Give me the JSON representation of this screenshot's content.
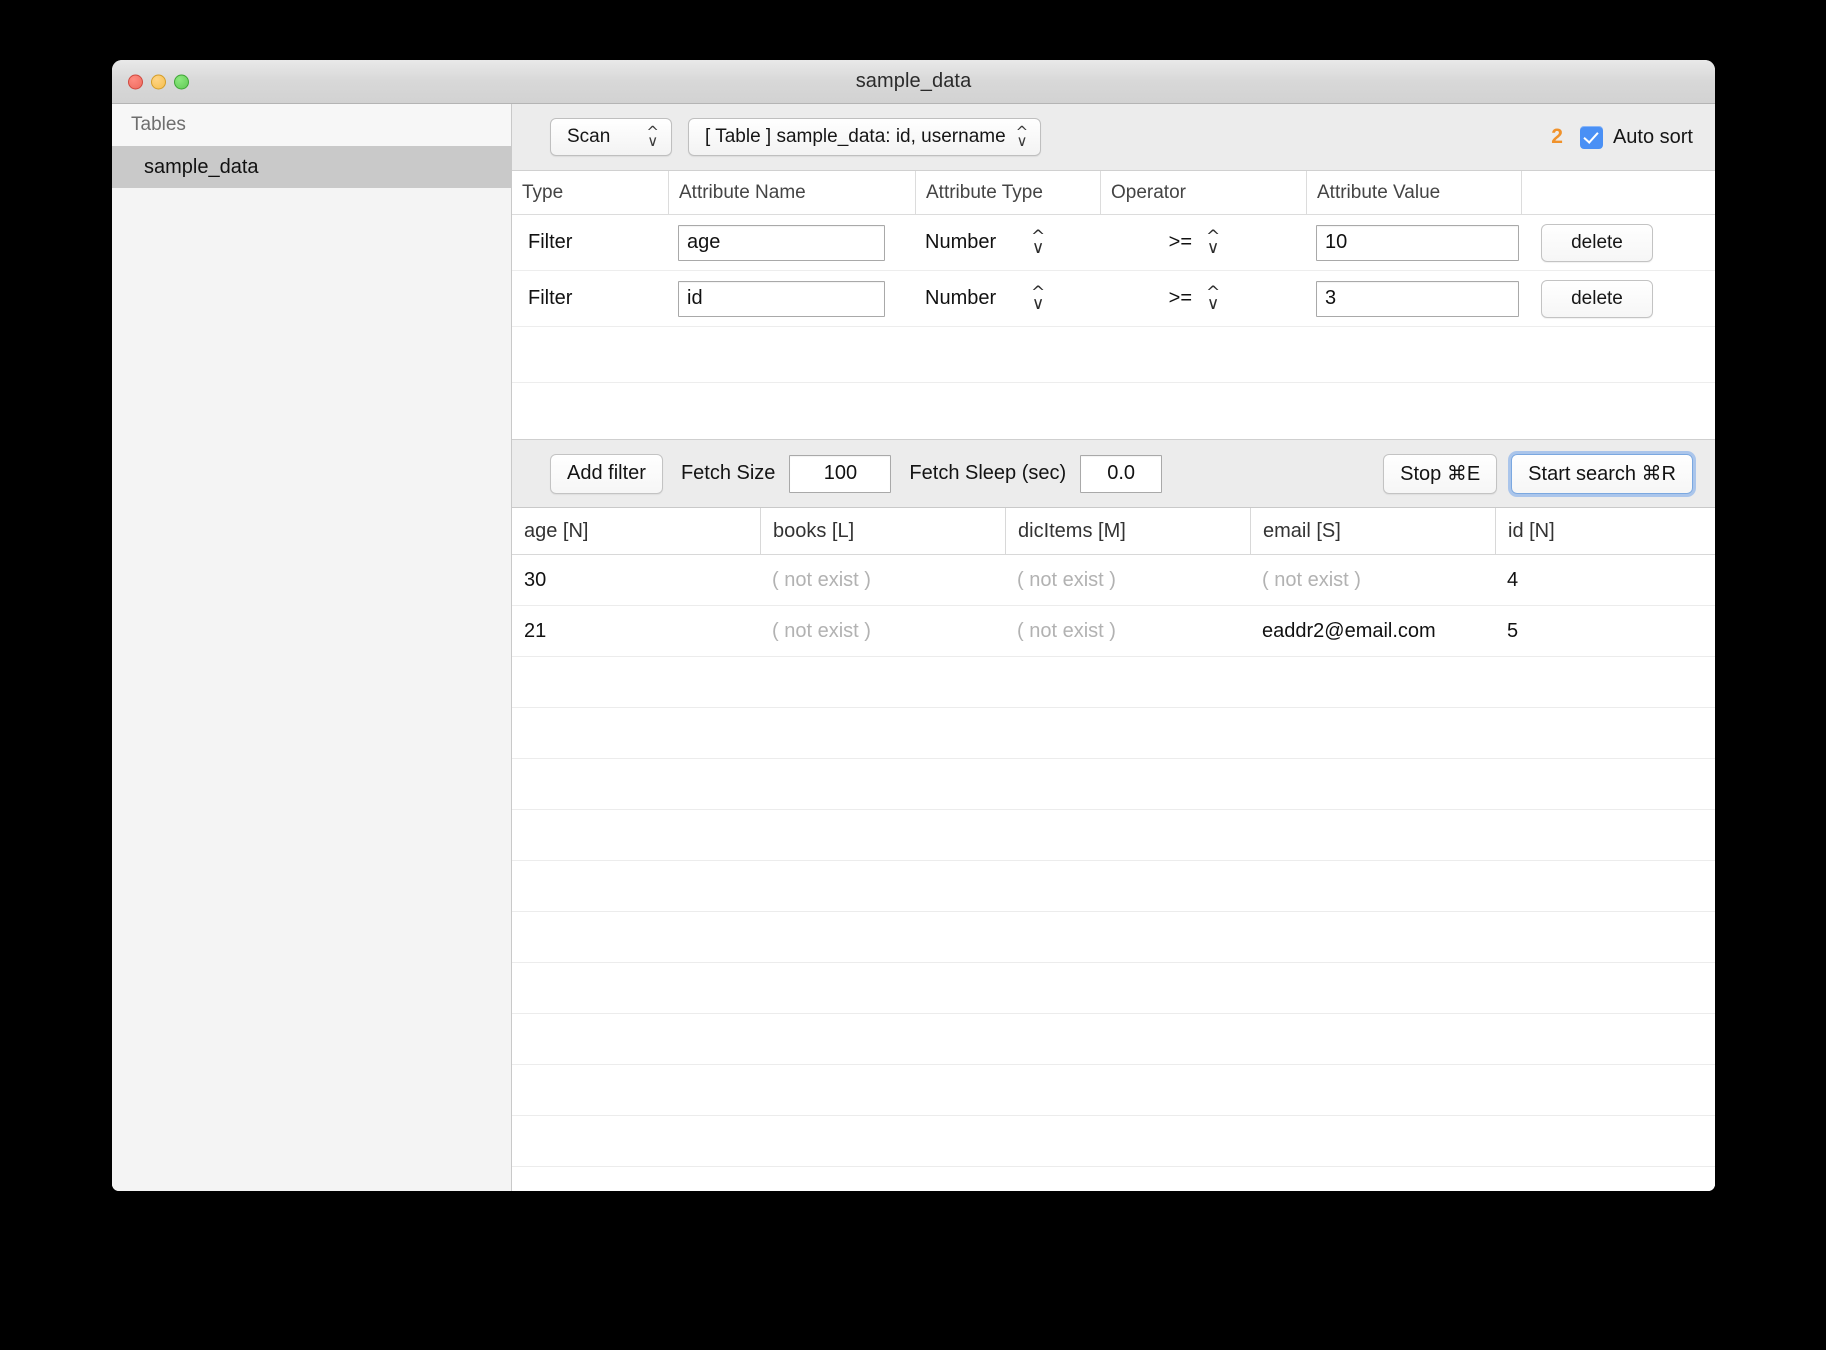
{
  "window": {
    "title": "sample_data",
    "traffic_lights": [
      "close",
      "minimize",
      "maximize"
    ]
  },
  "sidebar": {
    "header": "Tables",
    "items": [
      {
        "label": "sample_data",
        "selected": true
      }
    ]
  },
  "toolbar": {
    "scan_mode": "Scan",
    "table_selector": "[ Table ] sample_data: id, username",
    "result_count": "2",
    "auto_sort_label": "Auto sort",
    "auto_sort_checked": true,
    "accent_count_color": "#f0922b",
    "checkbox_color": "#4a90f5"
  },
  "filters": {
    "columns": [
      "Type",
      "Attribute Name",
      "Attribute Type",
      "Operator",
      "Attribute Value",
      ""
    ],
    "rows": [
      {
        "type": "Filter",
        "attribute_name": "age",
        "attribute_type": "Number",
        "operator": ">=",
        "attribute_value": "10",
        "delete_label": "delete"
      },
      {
        "type": "Filter",
        "attribute_name": "id",
        "attribute_type": "Number",
        "operator": ">=",
        "attribute_value": "3",
        "delete_label": "delete"
      }
    ],
    "empty_row_count": 2
  },
  "actions": {
    "add_filter": "Add filter",
    "fetch_size_label": "Fetch Size",
    "fetch_size_value": "100",
    "fetch_sleep_label": "Fetch Sleep (sec)",
    "fetch_sleep_value": "0.0",
    "stop": "Stop ⌘E",
    "start_search": "Start search ⌘R"
  },
  "results": {
    "columns": [
      "age [N]",
      "books [L]",
      "dicItems [M]",
      "email [S]",
      "id [N]"
    ],
    "rows": [
      {
        "age": "30",
        "books": "( not exist )",
        "dicItems": "( not exist )",
        "email": "( not exist )",
        "id": "4",
        "books_missing": true,
        "dicItems_missing": true,
        "email_missing": true
      },
      {
        "age": "21",
        "books": "( not exist )",
        "dicItems": "( not exist )",
        "email": "eaddr2@email.com",
        "id": "5",
        "books_missing": true,
        "dicItems_missing": true,
        "email_missing": false
      }
    ],
    "empty_row_count": 11
  }
}
